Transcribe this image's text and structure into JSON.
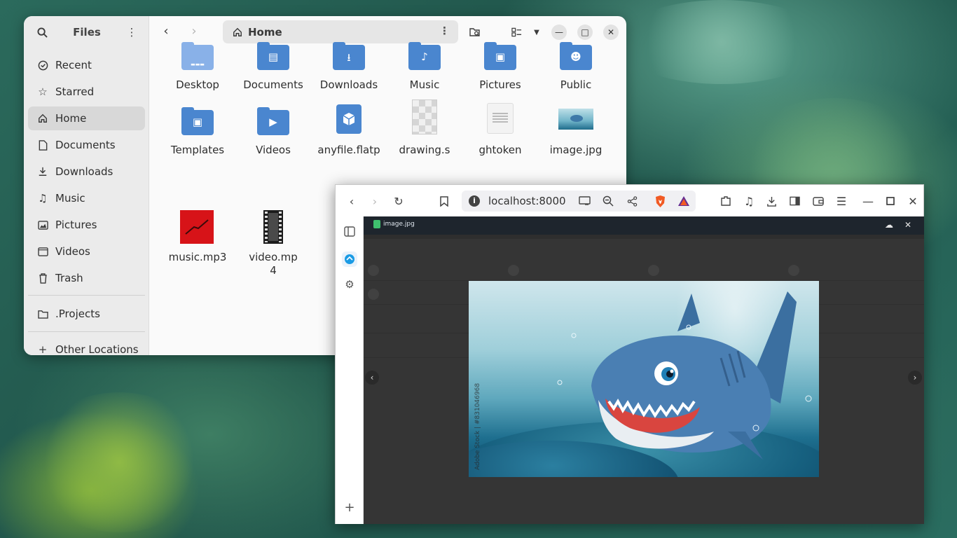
{
  "files_window": {
    "title": "Files",
    "path": "Home",
    "sidebar": [
      {
        "label": "Recent",
        "icon": "clock-icon"
      },
      {
        "label": "Starred",
        "icon": "star-icon"
      },
      {
        "label": "Home",
        "icon": "home-icon"
      },
      {
        "label": "Documents",
        "icon": "document-icon"
      },
      {
        "label": "Downloads",
        "icon": "download-icon"
      },
      {
        "label": "Music",
        "icon": "music-icon"
      },
      {
        "label": "Pictures",
        "icon": "picture-icon"
      },
      {
        "label": "Videos",
        "icon": "video-icon"
      },
      {
        "label": "Trash",
        "icon": "trash-icon"
      }
    ],
    "bookmarks": [
      {
        "label": ".Projects",
        "icon": "folder-icon"
      }
    ],
    "other_locations": "Other Locations",
    "files": [
      {
        "name": "Desktop",
        "type": "folder"
      },
      {
        "name": "Documents",
        "type": "folder"
      },
      {
        "name": "Downloads",
        "type": "folder"
      },
      {
        "name": "Music",
        "type": "folder"
      },
      {
        "name": "Pictures",
        "type": "folder"
      },
      {
        "name": "Public",
        "type": "folder"
      },
      {
        "name": "Templates",
        "type": "folder"
      },
      {
        "name": "Videos",
        "type": "folder"
      },
      {
        "name": "anyfile.flatp",
        "type": "flatpak"
      },
      {
        "name": "drawing.s",
        "type": "image"
      },
      {
        "name": "ghtoken",
        "type": "text"
      },
      {
        "name": "image.jpg",
        "type": "image"
      },
      {
        "name": "music.mp3",
        "type": "audio"
      },
      {
        "name": "video.mp",
        "name2": "4",
        "type": "video"
      }
    ]
  },
  "browser": {
    "url": "localhost:8000",
    "viewer": {
      "file_name": "image.jpg",
      "watermark": "Adobe Stock | #831046968"
    }
  },
  "colors": {
    "folder_blue": "#4a86cf",
    "viewer_bg": "#353535",
    "viewer_bar": "#1e252d"
  }
}
